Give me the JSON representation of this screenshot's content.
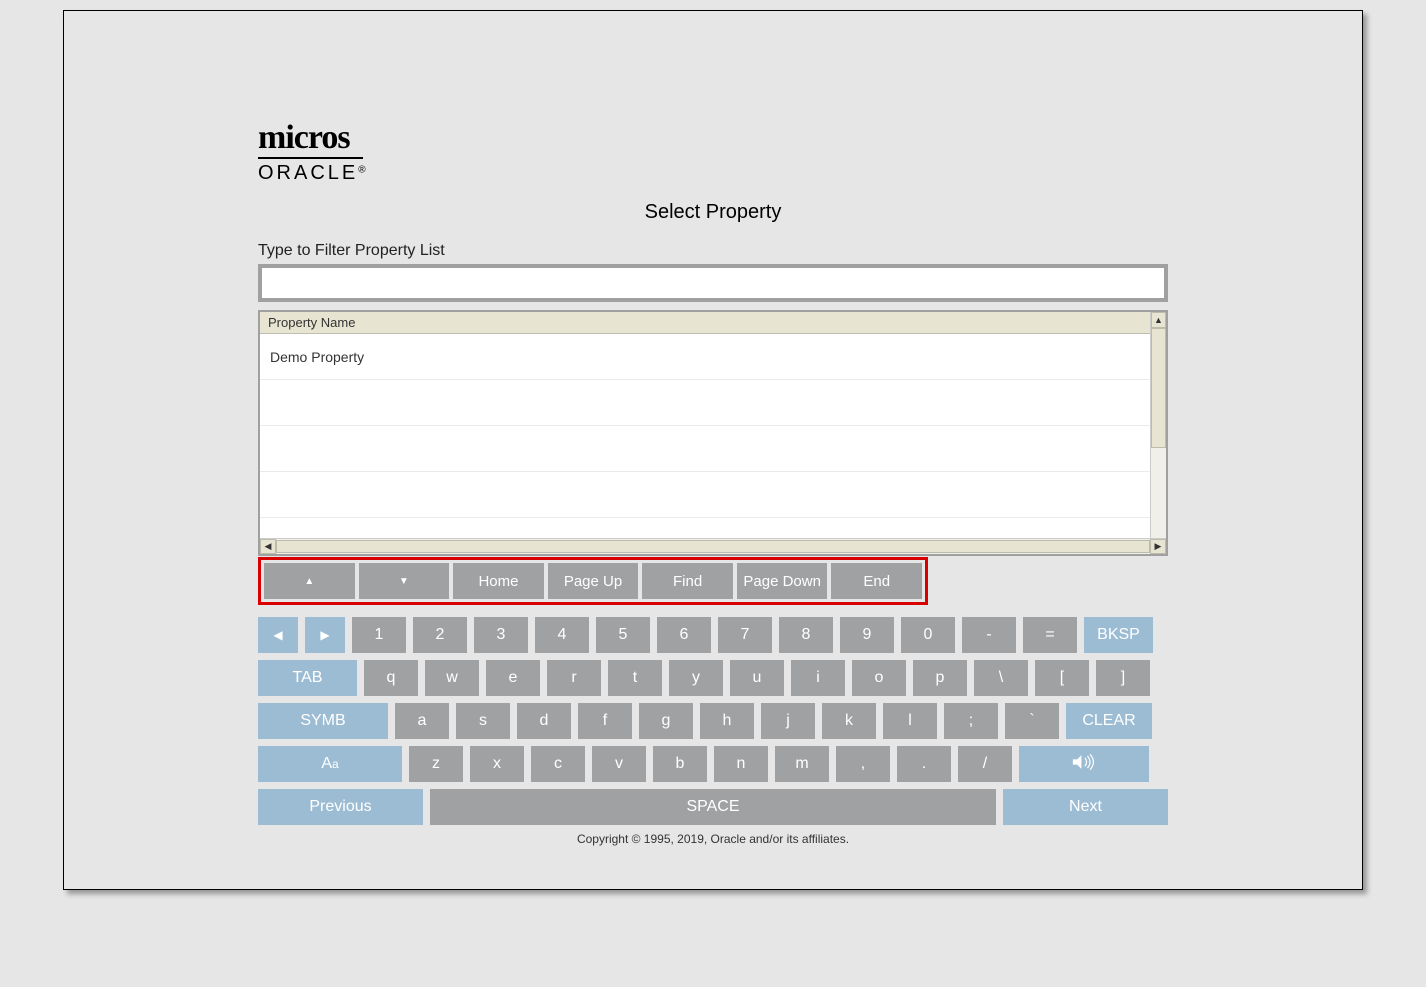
{
  "logo": {
    "line1": "micros",
    "line2": "ORACLE",
    "reg": "®"
  },
  "title": "Select Property",
  "filter": {
    "label": "Type to Filter Property List",
    "value": ""
  },
  "grid": {
    "header": "Property Name",
    "rows": [
      "Demo Property",
      "",
      "",
      ""
    ]
  },
  "nav": {
    "up": "▲",
    "down": "▼",
    "home": "Home",
    "pageup": "Page Up",
    "find": "Find",
    "pagedown": "Page Down",
    "end": "End"
  },
  "keyboard": {
    "row1_left": "◀",
    "row1_right": "▶",
    "row1": [
      "1",
      "2",
      "3",
      "4",
      "5",
      "6",
      "7",
      "8",
      "9",
      "0",
      "-",
      "="
    ],
    "row1_bksp": "BKSP",
    "row2_tab": "TAB",
    "row2": [
      "q",
      "w",
      "e",
      "r",
      "t",
      "y",
      "u",
      "i",
      "o",
      "p",
      "\\",
      "[",
      "]"
    ],
    "row3_symb": "SYMB",
    "row3": [
      "a",
      "s",
      "d",
      "f",
      "g",
      "h",
      "j",
      "k",
      "l",
      ";",
      "`"
    ],
    "row3_clear": "CLEAR",
    "row4_shift": "Aa",
    "row4": [
      "z",
      "x",
      "c",
      "v",
      "b",
      "n",
      "m",
      ",",
      ".",
      "/"
    ],
    "row5_prev": "Previous",
    "row5_space": "SPACE",
    "row5_next": "Next"
  },
  "footer": "Copyright © 1995, 2019, Oracle and/or its affiliates."
}
